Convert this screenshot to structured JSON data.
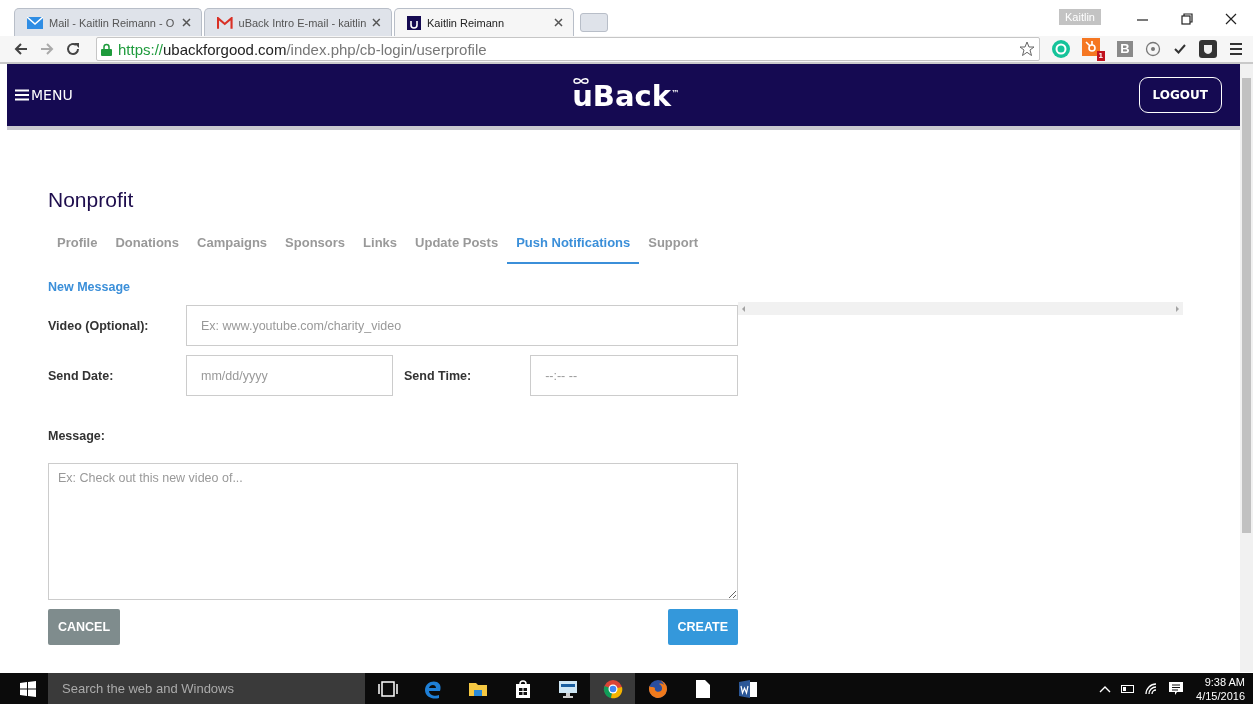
{
  "browser": {
    "tabs": [
      {
        "title": "Mail - Kaitlin Reimann - O",
        "kind": "mail",
        "selected": false
      },
      {
        "title": "uBack Intro E-mail - kaitlin",
        "kind": "gmail",
        "selected": false
      },
      {
        "title": "Kaitlin Reimann",
        "kind": "site",
        "selected": true
      }
    ],
    "profile": "Kaitlin",
    "address": {
      "scheme": "https://",
      "host": "ubackforgood.com",
      "path": "/index.php/cb-login/userprofile"
    },
    "extensions": [
      {
        "kind": "ring"
      },
      {
        "kind": "hub",
        "badge": "1"
      },
      {
        "kind": "letter",
        "label": "B"
      },
      {
        "kind": "target"
      },
      {
        "kind": "check"
      },
      {
        "kind": "shield"
      }
    ]
  },
  "site": {
    "menu": "MENU",
    "logo": "uBack",
    "logo_mark": "™",
    "logout": "LOGOUT"
  },
  "page": {
    "title": "Nonprofit",
    "tabs": [
      {
        "label": "Profile",
        "selected": false
      },
      {
        "label": "Donations",
        "selected": false
      },
      {
        "label": "Campaigns",
        "selected": false
      },
      {
        "label": "Sponsors",
        "selected": false
      },
      {
        "label": "Links",
        "selected": false
      },
      {
        "label": "Update Posts",
        "selected": false
      },
      {
        "label": "Push Notifications",
        "selected": true
      },
      {
        "label": "Support",
        "selected": false
      }
    ],
    "section": "New Message",
    "form": {
      "video_label": "Video (Optional):",
      "video_placeholder": "Ex: www.youtube.com/charity_video",
      "date_label": "Send Date:",
      "date_placeholder": "mm/dd/yyyy",
      "time_label": "Send Time:",
      "time_placeholder": "--:-- --",
      "message_label": "Message:",
      "message_placeholder": "Ex: Check out this new video of..."
    },
    "buttons": [
      {
        "label": "CANCEL",
        "kind": "cancel"
      },
      {
        "label": "CREATE",
        "kind": "create"
      }
    ]
  },
  "taskbar": {
    "search": "Search the web and Windows",
    "apps": [
      {
        "kind": "taskview",
        "selected": false
      },
      {
        "kind": "edge",
        "selected": false
      },
      {
        "kind": "folder",
        "selected": false
      },
      {
        "kind": "store",
        "selected": false
      },
      {
        "kind": "monitor",
        "selected": false
      },
      {
        "kind": "chrome",
        "selected": true
      },
      {
        "kind": "firefox",
        "selected": false
      },
      {
        "kind": "file",
        "selected": false
      },
      {
        "kind": "word",
        "selected": false
      }
    ],
    "time": "9:38 AM",
    "date": "4/15/2016"
  }
}
